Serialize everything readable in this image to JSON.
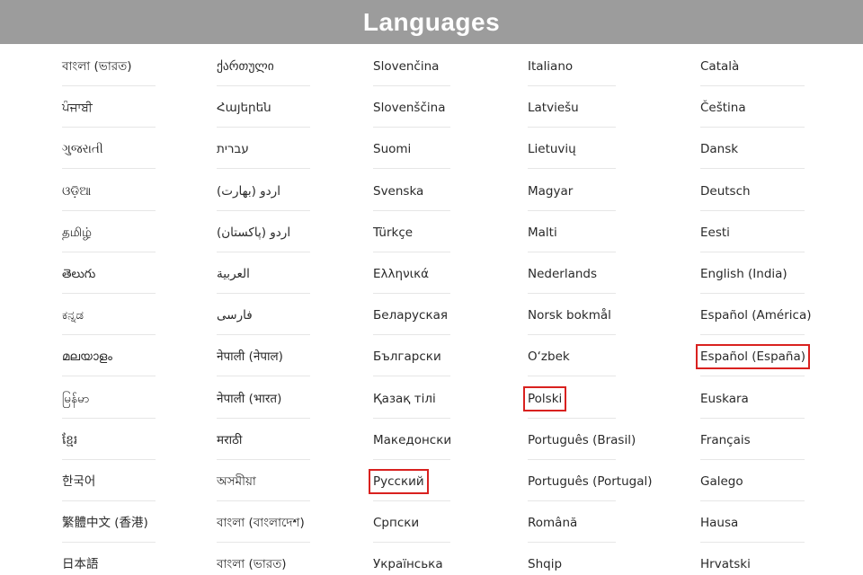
{
  "header": {
    "title": "Languages"
  },
  "highlight_color": "#d9211f",
  "columns": [
    {
      "items": [
        {
          "label": "বাংলা (ভারত)",
          "highlighted": false
        },
        {
          "label": "ਪੰਜਾਬੀ",
          "highlighted": false
        },
        {
          "label": "ગુજરાતી",
          "highlighted": false
        },
        {
          "label": "ଓଡ଼ିଆ",
          "highlighted": false
        },
        {
          "label": "தமிழ்",
          "highlighted": false
        },
        {
          "label": "తెలుగు",
          "highlighted": false
        },
        {
          "label": "ಕನ್ನಡ",
          "highlighted": false
        },
        {
          "label": "മലയാളം",
          "highlighted": false
        },
        {
          "label": "မြန်မာ",
          "highlighted": false
        },
        {
          "label": "ខ្មែរ",
          "highlighted": false
        },
        {
          "label": "한국어",
          "highlighted": false
        },
        {
          "label": "繁體中文 (香港)",
          "highlighted": false
        },
        {
          "label": "日本語",
          "highlighted": false
        }
      ]
    },
    {
      "items": [
        {
          "label": "ქართული",
          "highlighted": false
        },
        {
          "label": "Հայերեն",
          "highlighted": false
        },
        {
          "label": "עברית",
          "highlighted": false
        },
        {
          "label": "اردو (بھارت)",
          "highlighted": false
        },
        {
          "label": "اردو (پاکستان)",
          "highlighted": false
        },
        {
          "label": "العربية",
          "highlighted": false
        },
        {
          "label": "فارسی",
          "highlighted": false
        },
        {
          "label": "नेपाली (नेपाल)",
          "highlighted": false
        },
        {
          "label": "नेपाली (भारत)",
          "highlighted": false
        },
        {
          "label": "मराठी",
          "highlighted": false
        },
        {
          "label": "অসমীয়া",
          "highlighted": false
        },
        {
          "label": "বাংলা (বাংলাদেশ)",
          "highlighted": false
        },
        {
          "label": "বাংলা (ভারত)",
          "highlighted": false
        }
      ]
    },
    {
      "items": [
        {
          "label": "Slovenčina",
          "highlighted": false
        },
        {
          "label": "Slovenščina",
          "highlighted": false
        },
        {
          "label": "Suomi",
          "highlighted": false
        },
        {
          "label": "Svenska",
          "highlighted": false
        },
        {
          "label": "Türkçe",
          "highlighted": false
        },
        {
          "label": "Ελληνικά",
          "highlighted": false
        },
        {
          "label": "Беларуская",
          "highlighted": false
        },
        {
          "label": "Български",
          "highlighted": false
        },
        {
          "label": "Қазақ тілі",
          "highlighted": false
        },
        {
          "label": "Македонски",
          "highlighted": false
        },
        {
          "label": "Русский",
          "highlighted": true
        },
        {
          "label": "Српски",
          "highlighted": false
        },
        {
          "label": "Українська",
          "highlighted": false
        }
      ]
    },
    {
      "items": [
        {
          "label": "Italiano",
          "highlighted": false
        },
        {
          "label": "Latviešu",
          "highlighted": false
        },
        {
          "label": "Lietuvių",
          "highlighted": false
        },
        {
          "label": "Magyar",
          "highlighted": false
        },
        {
          "label": "Malti",
          "highlighted": false
        },
        {
          "label": "Nederlands",
          "highlighted": false
        },
        {
          "label": "Norsk bokmål",
          "highlighted": false
        },
        {
          "label": "O‘zbek",
          "highlighted": false
        },
        {
          "label": "Polski",
          "highlighted": true
        },
        {
          "label": "Português (Brasil)",
          "highlighted": false
        },
        {
          "label": "Português (Portugal)",
          "highlighted": false
        },
        {
          "label": "Română",
          "highlighted": false
        },
        {
          "label": "Shqip",
          "highlighted": false
        }
      ]
    },
    {
      "items": [
        {
          "label": "Català",
          "highlighted": false
        },
        {
          "label": "Čeština",
          "highlighted": false
        },
        {
          "label": "Dansk",
          "highlighted": false
        },
        {
          "label": "Deutsch",
          "highlighted": false
        },
        {
          "label": "Eesti",
          "highlighted": false
        },
        {
          "label": "English (India)",
          "highlighted": false
        },
        {
          "label": "Español (América)",
          "highlighted": false
        },
        {
          "label": "Español (España)",
          "highlighted": true
        },
        {
          "label": "Euskara",
          "highlighted": false
        },
        {
          "label": "Français",
          "highlighted": false
        },
        {
          "label": "Galego",
          "highlighted": false
        },
        {
          "label": "Hausa",
          "highlighted": false
        },
        {
          "label": "Hrvatski",
          "highlighted": false
        }
      ]
    }
  ]
}
